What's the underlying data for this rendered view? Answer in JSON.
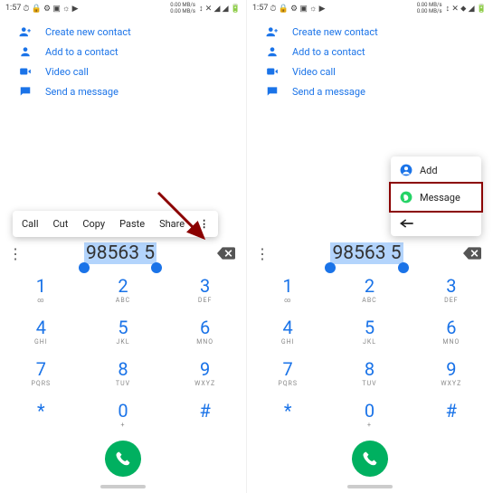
{
  "status": {
    "time": "1:57",
    "speed_top": "0.00 MB/s",
    "speed_bot": "0.00 MB/s"
  },
  "actions": {
    "create": "Create new contact",
    "add": "Add to a contact",
    "video": "Video call",
    "message": "Send a message"
  },
  "text_menu": {
    "call": "Call",
    "cut": "Cut",
    "copy": "Copy",
    "paste": "Paste",
    "share": "Share"
  },
  "popup": {
    "add": "Add",
    "message": "Message"
  },
  "dial": {
    "number": "98563 5"
  },
  "keys": [
    {
      "d": "1",
      "l": "∞"
    },
    {
      "d": "2",
      "l": "ABC"
    },
    {
      "d": "3",
      "l": "DEF"
    },
    {
      "d": "4",
      "l": "GHI"
    },
    {
      "d": "5",
      "l": "JKL"
    },
    {
      "d": "6",
      "l": "MNO"
    },
    {
      "d": "7",
      "l": "PQRS"
    },
    {
      "d": "8",
      "l": "TUV"
    },
    {
      "d": "9",
      "l": "WXYZ"
    },
    {
      "d": "*",
      "l": ""
    },
    {
      "d": "0",
      "l": "+"
    },
    {
      "d": "#",
      "l": ""
    }
  ]
}
